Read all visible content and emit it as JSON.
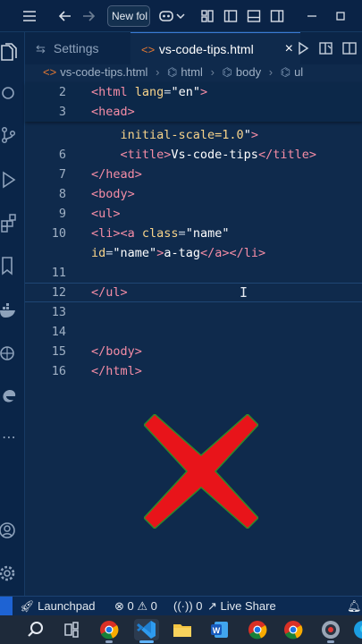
{
  "titlebar": {
    "search_text": "New fol",
    "icons": [
      "menu-icon",
      "back-arrow-icon",
      "forward-arrow-icon",
      "copilot-icon",
      "chevron-down-icon",
      "layout-icon",
      "toggle-sidebar-icon",
      "toggle-panel-icon",
      "toggle-secondary-sidebar-icon",
      "minimize-icon",
      "maximize-icon"
    ]
  },
  "activitybar": {
    "icons": [
      "explorer-icon",
      "search-icon",
      "source-control-icon",
      "run-debug-icon",
      "extensions-icon",
      "bookmark-icon",
      "docker-icon",
      "remote-explorer-icon",
      "edge-icon",
      "more-icon",
      "account-icon",
      "settings-gear-icon"
    ]
  },
  "tabs": [
    {
      "label": "Settings",
      "icon": "settings-file-icon",
      "active": false
    },
    {
      "label": "vs-code-tips.html",
      "icon": "html-file-icon",
      "active": true
    }
  ],
  "tab_close": "×",
  "breadcrumb": [
    "vs-code-tips.html",
    "html",
    "body",
    "ul"
  ],
  "editor": {
    "sticky_lines": [
      {
        "n": "2",
        "tokens": [
          [
            "tag",
            "<html "
          ],
          [
            "attr",
            "lang"
          ],
          [
            "plain",
            "="
          ],
          [
            "str",
            "\"en\""
          ],
          [
            "tag",
            ">"
          ]
        ]
      },
      {
        "n": "3",
        "tokens": [
          [
            "tag",
            "<head>"
          ]
        ]
      }
    ],
    "lines": [
      {
        "n": "",
        "tokens": [
          [
            "attr",
            "    initial-scale=1.0"
          ],
          [
            "str",
            "\""
          ],
          [
            "tag",
            ">"
          ]
        ]
      },
      {
        "n": "6",
        "tokens": [
          [
            "tag",
            "    <title>"
          ],
          [
            "txt",
            "Vs-code-tips"
          ],
          [
            "tag",
            "</title>"
          ]
        ]
      },
      {
        "n": "7",
        "tokens": [
          [
            "tag",
            "</head>"
          ]
        ]
      },
      {
        "n": "8",
        "tokens": [
          [
            "tag",
            "<body>"
          ]
        ]
      },
      {
        "n": "9",
        "tokens": [
          [
            "tag",
            "<ul>"
          ]
        ]
      },
      {
        "n": "10",
        "tokens": [
          [
            "tag",
            "<li><a "
          ],
          [
            "attr",
            "class"
          ],
          [
            "plain",
            "="
          ],
          [
            "str",
            "\"name\""
          ]
        ]
      },
      {
        "n": "",
        "tokens": [
          [
            "attr",
            "id"
          ],
          [
            "plain",
            "="
          ],
          [
            "str",
            "\"name\""
          ],
          [
            "tag",
            ">"
          ],
          [
            "txt",
            "a-tag"
          ],
          [
            "tag",
            "</a></li>"
          ]
        ]
      },
      {
        "n": "11",
        "tokens": []
      },
      {
        "n": "12",
        "tokens": [
          [
            "tag",
            "</ul>"
          ]
        ]
      },
      {
        "n": "13",
        "tokens": []
      },
      {
        "n": "14",
        "tokens": []
      },
      {
        "n": "15",
        "tokens": [
          [
            "tag",
            "</body>"
          ]
        ]
      },
      {
        "n": "16",
        "tokens": [
          [
            "tag",
            "</html>"
          ]
        ]
      }
    ]
  },
  "statusbar": {
    "launchpad": "Launchpad",
    "errors": "0",
    "warnings": "0",
    "ports": "0",
    "live_share": "Live Share"
  },
  "taskbar": {
    "apps": [
      "windows-start-icon",
      "search-icon",
      "task-view-icon",
      "chrome-icon",
      "vscode-icon",
      "file-explorer-icon",
      "word-icon",
      "chrome-icon",
      "chrome-icon",
      "recorder-icon",
      "edge-icon"
    ]
  },
  "colors": {
    "background": "#0f2a4c",
    "tag": "#f58da6",
    "attribute": "#f7d38a",
    "string": "#ffffff",
    "x_mark": "#e8141a"
  }
}
